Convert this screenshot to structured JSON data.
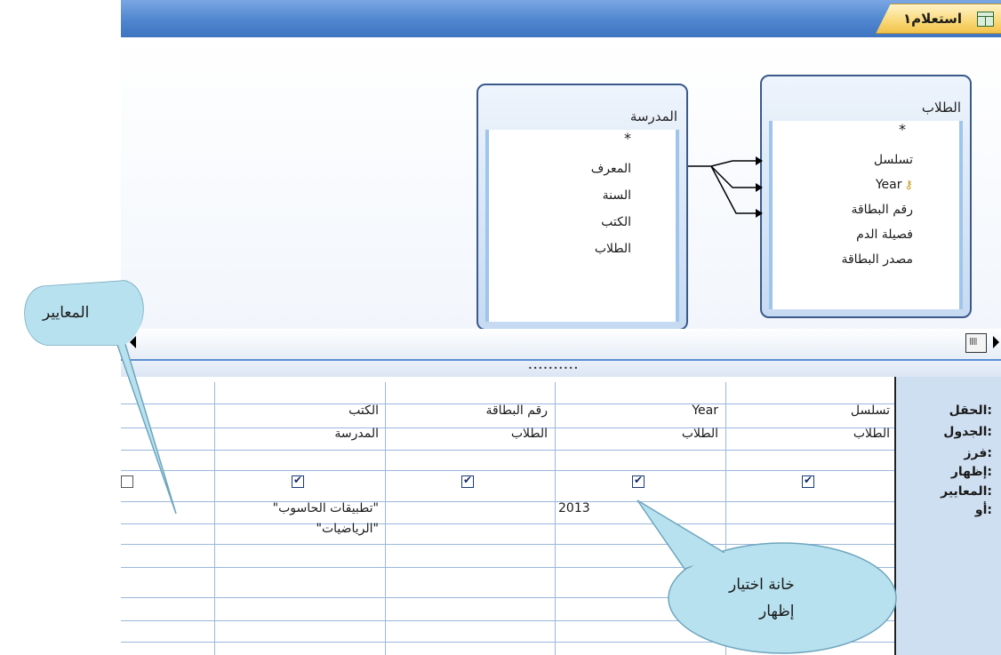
{
  "window": {
    "doc_tab_title": "استعلام١"
  },
  "tables": [
    {
      "name": "المدرسة",
      "fields": [
        "*",
        "المعرف",
        "السنة",
        "الكتب",
        "الطلاب"
      ]
    },
    {
      "name": "الطلاب",
      "fields": [
        "*",
        "تسلسل",
        "Year",
        "رقم البطاقة",
        "فصيلة الدم",
        "مصدر البطاقة"
      ],
      "primary_key": "Year"
    }
  ],
  "grid": {
    "row_labels": [
      "الحقل:",
      "الجدول:",
      "فرز:",
      "إظهار:",
      "المعايير:",
      "أو:"
    ],
    "columns": [
      {
        "field": "تسلسل",
        "table": "الطلاب",
        "show": true,
        "criteria": "",
        "or": ""
      },
      {
        "field": "Year",
        "table": "الطلاب",
        "show": true,
        "criteria": "2013",
        "or": ""
      },
      {
        "field": "رقم البطاقة",
        "table": "الطلاب",
        "show": true,
        "criteria": "",
        "or": ""
      },
      {
        "field": "الكتب",
        "table": "المدرسة",
        "show": true,
        "criteria": "\"تطبيقات الحاسوب\"",
        "or": "\"الرياضيات\""
      },
      {
        "field": "",
        "table": "",
        "show": false,
        "criteria": "",
        "or": ""
      }
    ]
  },
  "callouts": {
    "criteria": "المعايير",
    "show_checkbox_line1": "خانة اختيار",
    "show_checkbox_line2": "إظهار"
  },
  "icons": [
    "query-icon",
    "key-icon",
    "scroll-left-icon",
    "scroll-right-icon",
    "checkbox-icon"
  ],
  "colors": {
    "title_band": "#4f86cf",
    "doc_tab": "#f9d877",
    "grid_label_bg": "#cfdff2"
  }
}
